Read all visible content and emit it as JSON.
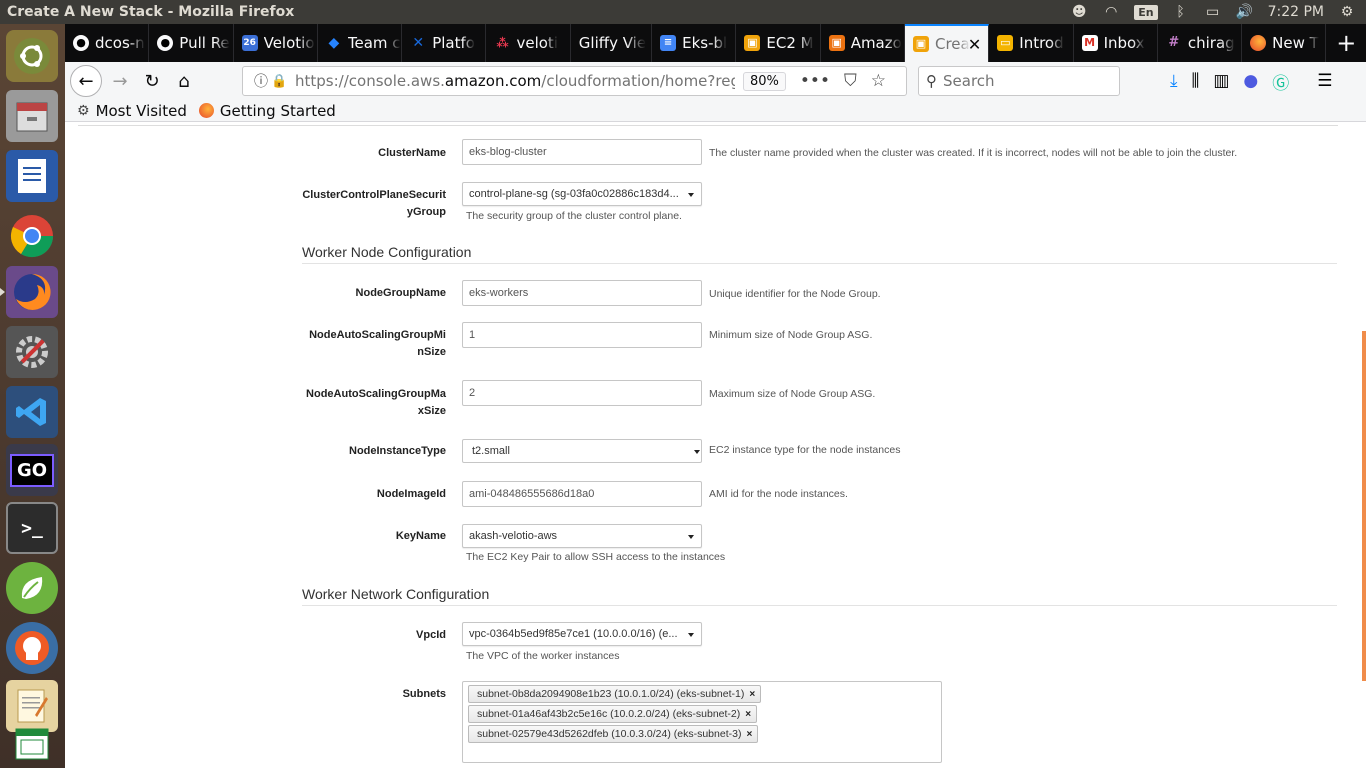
{
  "system": {
    "window_title": "Create A New Stack - Mozilla Firefox",
    "language": "En",
    "clock": "7:22 PM"
  },
  "launcher": {
    "items": [
      {
        "icon": "ubuntu-dash-icon"
      },
      {
        "icon": "files-icon"
      },
      {
        "icon": "libreoffice-writer-icon"
      },
      {
        "icon": "chrome-icon"
      },
      {
        "icon": "firefox-icon"
      },
      {
        "icon": "settings-icon"
      },
      {
        "icon": "vscode-icon"
      },
      {
        "icon": "goland-icon",
        "text": "GO"
      },
      {
        "icon": "terminal-icon"
      },
      {
        "icon": "spring-icon"
      },
      {
        "icon": "postman-icon"
      },
      {
        "icon": "text-editor-icon"
      },
      {
        "icon": "spreadsheet-icon"
      }
    ]
  },
  "tabs": [
    {
      "label": "dcos-n",
      "icon": "github-icon",
      "color": "#222222"
    },
    {
      "label": "Pull Re",
      "icon": "github-icon",
      "color": "#222222"
    },
    {
      "label": "Velotio",
      "icon": "calendar-icon",
      "color": "#3b6fd6",
      "icon_text": "26"
    },
    {
      "label": "Team c",
      "icon": "jira-icon",
      "color": "#2684ff"
    },
    {
      "label": "Platfo",
      "icon": "confluence-icon",
      "color": "#1868db"
    },
    {
      "label": "veloti",
      "icon": "asana-icon",
      "color": "#e8384f"
    },
    {
      "label": "Gliffy Vie",
      "icon": "none",
      "color": "#0c0c0d"
    },
    {
      "label": "Eks-bl",
      "icon": "docs-icon",
      "color": "#4285f4"
    },
    {
      "label": "EC2 M",
      "icon": "aws-icon",
      "color": "#f0a30a"
    },
    {
      "label": "Amazo",
      "icon": "aws-icon",
      "color": "#ec7211"
    },
    {
      "label": "Crea",
      "icon": "aws-icon",
      "color": "#f0a30a",
      "active": true
    },
    {
      "label": "Introd",
      "icon": "slides-icon",
      "color": "#f4b400"
    },
    {
      "label": "Inbox",
      "icon": "gmail-icon",
      "color": "#d93025"
    },
    {
      "label": "chirag",
      "icon": "slack-icon",
      "color": "#611f69"
    },
    {
      "label": "New T",
      "icon": "firefox-icon",
      "color": "#e66000"
    }
  ],
  "new_tab": "+",
  "navbar": {
    "url_prefix": "https://console.aws.",
    "url_domain": "amazon.com",
    "url_suffix": "/cloudformation/home?regio",
    "zoom": "80%",
    "search_placeholder": "Search"
  },
  "bookmarks": [
    {
      "label": "Most Visited",
      "icon": "gear-icon"
    },
    {
      "label": "Getting Started",
      "icon": "firefox-icon"
    }
  ],
  "form": {
    "cluster_name": {
      "label": "ClusterName",
      "value": "eks-blog-cluster",
      "help": "The cluster name provided when the cluster was created. If it is incorrect, nodes will not be able to join the cluster."
    },
    "control_plane_sg": {
      "label_line1": "ClusterControlPlaneSecurit",
      "label_line2": "yGroup",
      "value": "control-plane-sg (sg-03fa0c02886c183d4...",
      "help": "The security group of the cluster control plane."
    },
    "worker_node_section": "Worker Node Configuration",
    "node_group_name": {
      "label": "NodeGroupName",
      "value": "eks-workers",
      "help": "Unique identifier for the Node Group."
    },
    "asg_min": {
      "label_line1": "NodeAutoScalingGroupMi",
      "label_line2": "nSize",
      "value": "1",
      "help": "Minimum size of Node Group ASG."
    },
    "asg_max": {
      "label_line1": "NodeAutoScalingGroupMa",
      "label_line2": "xSize",
      "value": "2",
      "help": "Maximum size of Node Group ASG."
    },
    "instance_type": {
      "label": "NodeInstanceType",
      "value": "t2.small",
      "help": "EC2 instance type for the node instances"
    },
    "image_id": {
      "label": "NodeImageId",
      "value": "ami-048486555686d18a0",
      "help": "AMI id for the node instances."
    },
    "key_name": {
      "label": "KeyName",
      "value": "akash-velotio-aws",
      "help": "The EC2 Key Pair to allow SSH access to the instances"
    },
    "worker_network_section": "Worker Network Configuration",
    "vpc_id": {
      "label": "VpcId",
      "value": "vpc-0364b5ed9f85e7ce1 (10.0.0.0/16) (e...",
      "help": "The VPC of the worker instances"
    },
    "subnets": {
      "label": "Subnets",
      "items": [
        "subnet-0b8da2094908e1b23 (10.0.1.0/24) (eks-subnet-1)",
        "subnet-01a46af43b2c5e16c (10.0.2.0/24) (eks-subnet-2)",
        "subnet-02579e43d5262dfeb (10.0.3.0/24) (eks-subnet-3)"
      ],
      "remove_glyph": "×"
    }
  },
  "colors": {
    "accent": "#0a84ff",
    "scrollbar": "#f08c4a",
    "panel": "#3c3b37"
  }
}
